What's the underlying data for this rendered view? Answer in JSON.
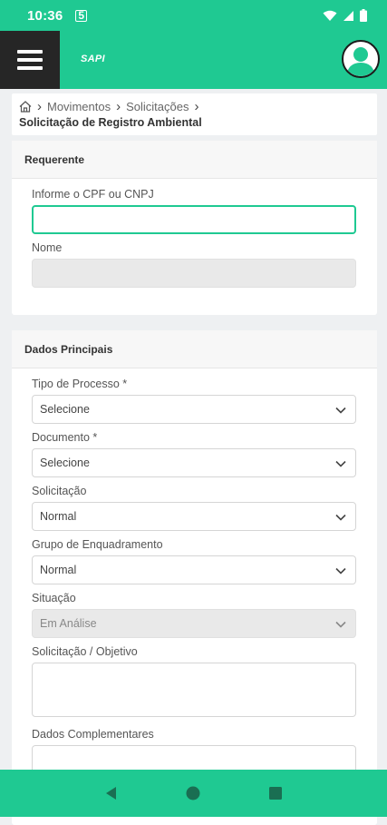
{
  "status": {
    "time": "10:36",
    "sim_icon": "sim-card-icon"
  },
  "app": {
    "brand": "SAPI"
  },
  "breadcrumb": {
    "items": [
      "Movimentos",
      "Solicitações"
    ],
    "title": "Solicitação de Registro Ambiental"
  },
  "requerente": {
    "header": "Requerente",
    "cpf_label": "Informe o CPF ou CNPJ",
    "cpf_value": "",
    "nome_label": "Nome",
    "nome_value": ""
  },
  "dados": {
    "header": "Dados Principais",
    "tipo_label": "Tipo de Processo *",
    "tipo_value": "Selecione",
    "documento_label": "Documento *",
    "documento_value": "Selecione",
    "solicitacao_label": "Solicitação",
    "solicitacao_value": "Normal",
    "grupo_label": "Grupo de Enquadramento",
    "grupo_value": "Normal",
    "situacao_label": "Situação",
    "situacao_value": "Em Análise",
    "objetivo_label": "Solicitação / Objetivo",
    "complementares_label": "Dados Complementares"
  },
  "colors": {
    "accent": "#1fc992",
    "menu_bg": "#262626"
  }
}
